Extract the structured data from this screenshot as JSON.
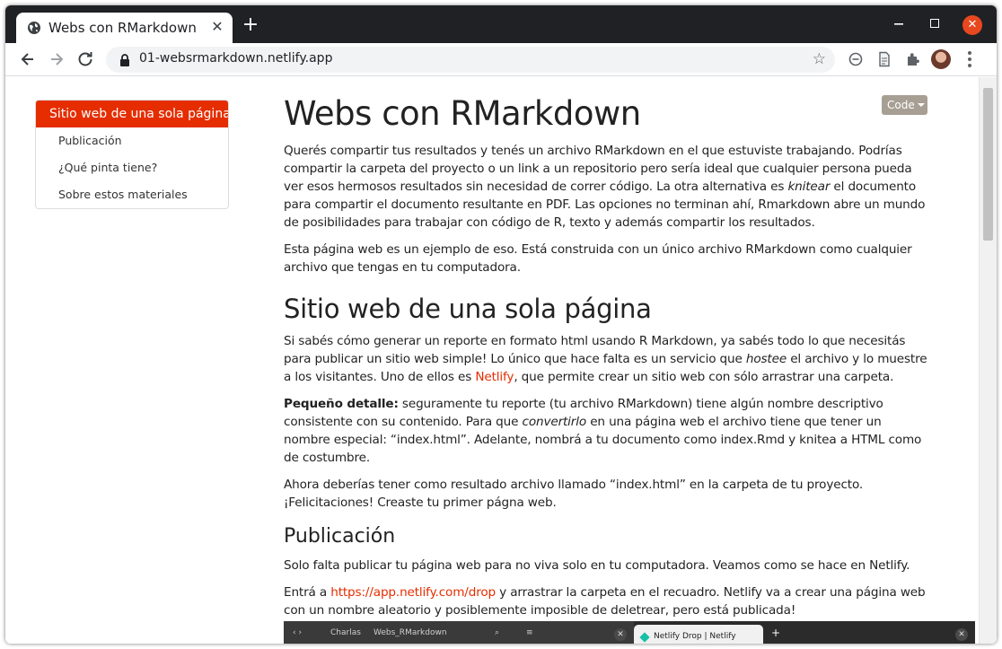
{
  "browser": {
    "tab_title": "Webs con RMarkdown",
    "tab_close": "✕",
    "new_tab": "+",
    "url": "01-websrmarkdown.netlify.app",
    "window_close": "✕"
  },
  "toc": {
    "items": [
      {
        "label": "Sitio web de una sola página",
        "active": true
      },
      {
        "label": "Publicación"
      },
      {
        "label": "¿Qué pinta tiene?"
      },
      {
        "label": "Sobre estos materiales"
      }
    ]
  },
  "code_button": {
    "label": "Code"
  },
  "content": {
    "title": "Webs con RMarkdown",
    "intro_p1_a": "Querés compartir tus resultados y tenés un archivo RMarkdown en el que estuviste trabajando. Podrías compartir la carpeta del proyecto o un link a un repositorio pero sería ideal que cualquier persona pueda ver esos hermosos resultados sin necesidad de correr código. La otra alternativa es ",
    "intro_p1_em": "knitear",
    "intro_p1_b": " el documento para compartir el documento resultante en PDF. Las opciones no terminan ahí, Rmarkdown abre un mundo de posibilidades para trabajar con código de R, texto y además compartir los resultados.",
    "intro_p2": "Esta página web es un ejemplo de eso. Está construida con un único archivo RMarkdown como cualquier archivo que tengas en tu computadora.",
    "section1_title": "Sitio web de una sola página",
    "s1_p1_a": "Si sabés cómo generar un reporte en formato html usando R Markdown, ya sabés todo lo que necesitás para publicar un sitio web simple! Lo único que hace falta es un servicio que ",
    "s1_p1_em": "hostee",
    "s1_p1_b": " el archivo y lo muestre a los visitantes. Uno de ellos es ",
    "s1_p1_link": "Netlify",
    "s1_p1_c": ", que permite crear un sitio web con sólo arrastrar una carpeta.",
    "s1_p2_bold": "Pequeño detalle:",
    "s1_p2_a": " seguramente tu reporte (tu archivo RMarkdown) tiene algún nombre descriptivo consistente con su contenido. Para que ",
    "s1_p2_em": "convertirlo",
    "s1_p2_b": " en una página web el archivo tiene que tener un nombre especial: “index.html”. Adelante, nombrá a tu documento como index.Rmd y knitea a HTML como de costumbre.",
    "s1_p3": "Ahora deberías tener como resultado archivo llamado “index.html” en la carpeta de tu proyecto. ¡Felicitaciones! Creaste tu primer págna web.",
    "section2_title": "Publicación",
    "s2_p1": "Solo falta publicar tu página web para no viva solo en tu computadora. Veamos como se hace en Netlify.",
    "s2_p2_a": "Entrá a ",
    "s2_p2_link": "https://app.netlify.com/drop",
    "s2_p2_b": " y arrastrar la carpeta en el recuadro. Netlify va a crear una página web con un nombre aleatorio y posiblemente imposible de deletrear, pero está publicada!"
  },
  "embedded_screenshot": {
    "crumb_1": "Charlas",
    "crumb_2": "Webs_RMarkdown",
    "tab_title": "Netlify Drop | Netlify",
    "plus": "+"
  },
  "colors": {
    "accent": "#e52d00",
    "code_button": "#a89f94",
    "chrome_dark": "#202124"
  }
}
